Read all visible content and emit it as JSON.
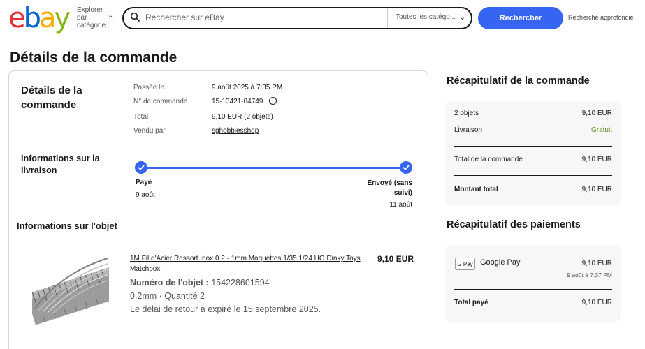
{
  "header": {
    "explore_label": "Explorer par catégorie",
    "search_placeholder": "Rechercher sur eBay",
    "category_value": "Toutes les catégo...",
    "search_button": "Rechercher",
    "advanced_link": "Recherche approfondie"
  },
  "page_title": "Détails de la commande",
  "order": {
    "section_title": "Détails de la commande",
    "fields": [
      {
        "label": "Passée le",
        "value": "9 août 2025 à 7:35 PM"
      },
      {
        "label": "N° de commande",
        "value": "15-13421-84749"
      },
      {
        "label": "Total",
        "value": "9,10 EUR (2 objets)"
      },
      {
        "label": "Vendu par",
        "value": "sghobbiesshop"
      }
    ]
  },
  "delivery": {
    "section_title": "Informations sur la livraison",
    "steps": [
      {
        "label": "Payé",
        "date": "9 août"
      },
      {
        "label": "Envoyé (sans suivi)",
        "date": "11 août"
      }
    ]
  },
  "item": {
    "section_title": "Informations sur l'objet",
    "title": "1M Fil d'Acier Ressort Inox 0.2 - 1mm Maquettes 1/35 1/24 HO Dinky Toys Matchbox",
    "price": "9,10 EUR",
    "number_label": "Numéro de l'objet :",
    "number_value": "154228601594",
    "variant": "0.2mm · Quantité 2",
    "return_note": "Le délai de retour a expiré le 15 septembre 2025."
  },
  "summary": {
    "title": "Récapitulatif de la commande",
    "rows": [
      {
        "label": "2 objets",
        "value": "9,10 EUR"
      },
      {
        "label": "Livraison",
        "value": "Gratuit"
      },
      {
        "label": "Total de la commande",
        "value": "9,10 EUR"
      },
      {
        "label": "Montant total",
        "value": "9,10 EUR"
      }
    ],
    "free_color": "#5b8a16"
  },
  "payments": {
    "title": "Récapitulatif des paiements",
    "method_badge": "G Pay",
    "method": "Google Pay",
    "amount": "9,10 EUR",
    "date": "9 août à 7:37 PM",
    "total_label": "Total payé",
    "total_value": "9,10 EUR"
  },
  "colors": {
    "accent": "#3665f3"
  }
}
